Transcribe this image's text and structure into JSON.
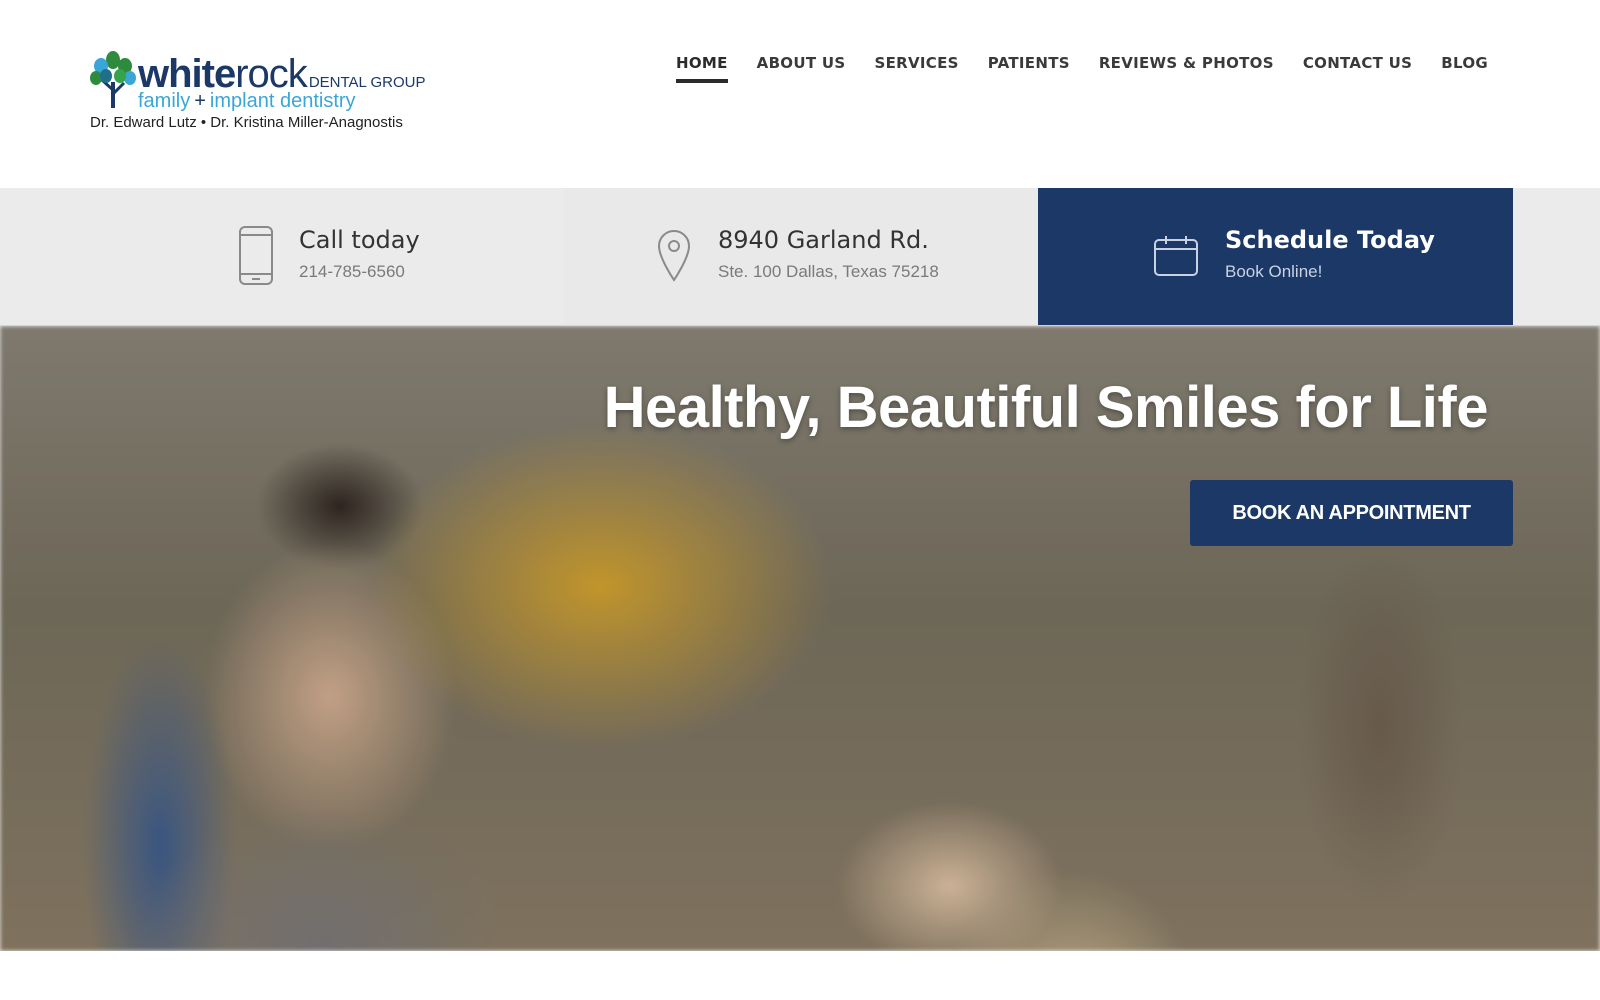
{
  "logo": {
    "word_bold": "white",
    "word_light": "rock",
    "group": "DENTAL GROUP",
    "tagline_left": "family",
    "tagline_plus": "+",
    "tagline_right": "implant dentistry",
    "doctors": "Dr. Edward Lutz • Dr. Kristina Miller-Anagnostis"
  },
  "nav": {
    "items": [
      {
        "label": "HOME"
      },
      {
        "label": "ABOUT US"
      },
      {
        "label": "SERVICES"
      },
      {
        "label": "PATIENTS"
      },
      {
        "label": "REVIEWS & PHOTOS"
      },
      {
        "label": "CONTACT US"
      },
      {
        "label": "BLOG"
      }
    ],
    "active": "HOME"
  },
  "infobar": {
    "phone": {
      "icon": "phone-icon",
      "title": "Call today",
      "sub": "214-785-6560"
    },
    "address": {
      "icon": "map-pin-icon",
      "title": "8940 Garland Rd.",
      "sub": "Ste. 100 Dallas, Texas 75218"
    },
    "schedule": {
      "icon": "calendar-icon",
      "title": "Schedule Today",
      "sub": "Book Online!"
    }
  },
  "hero": {
    "headline": "Healthy, Beautiful Smiles for Life",
    "cta_label": "BOOK AN APPOINTMENT"
  },
  "colors": {
    "brand_navy": "#1b3866",
    "brand_light_blue": "#3aa6d8",
    "infobar_bg": "#ebebeb"
  }
}
